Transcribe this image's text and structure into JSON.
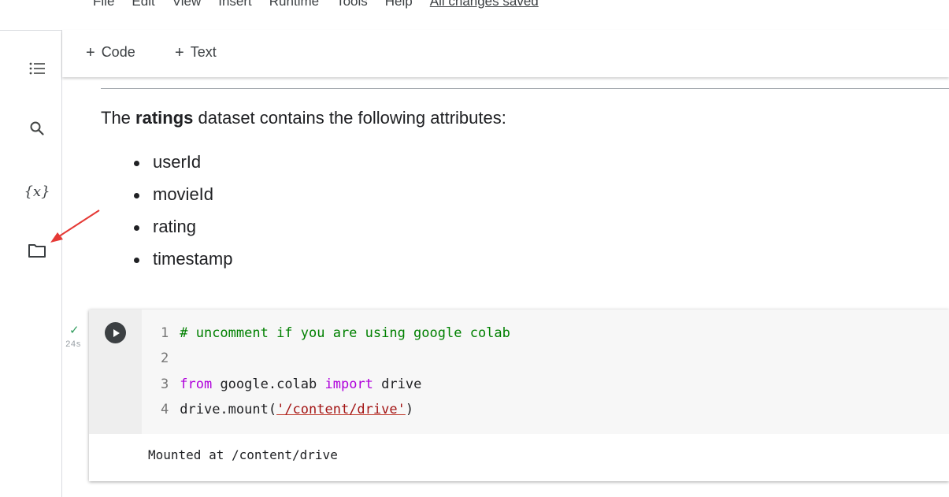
{
  "menubar": {
    "items": [
      "File",
      "Edit",
      "View",
      "Insert",
      "Runtime",
      "Tools",
      "Help"
    ],
    "save_status": "All changes saved"
  },
  "sidebar": {
    "icons": [
      "table-of-contents-icon",
      "search-icon",
      "variables-icon",
      "folder-icon"
    ],
    "variables_label": "{x}"
  },
  "toolbar": {
    "add_code_label": "Code",
    "add_text_label": "Text",
    "plus": "+"
  },
  "text_cell": {
    "desc_before": "The ",
    "desc_bold": "ratings",
    "desc_after": " dataset contains the following attributes:",
    "attributes": [
      "userId",
      "movieId",
      "rating",
      "timestamp"
    ]
  },
  "code_cell": {
    "status": "✓",
    "exec_time": "24s",
    "lines": [
      {
        "num": "1",
        "comment": "# uncomment if you are using google colab"
      },
      {
        "num": "2"
      },
      {
        "num": "3",
        "kw1": "from",
        "mod": " google.colab ",
        "kw2": "import",
        "rest": " drive"
      },
      {
        "num": "4",
        "pre": "drive.mount(",
        "str": "'/content/drive'",
        "post": ")"
      }
    ],
    "output": "Mounted at /content/drive"
  },
  "colors": {
    "accent_arrow": "#e53935",
    "success": "#2e9b5c",
    "keyword": "#af00db",
    "comment": "#008000",
    "string": "#a31515"
  }
}
